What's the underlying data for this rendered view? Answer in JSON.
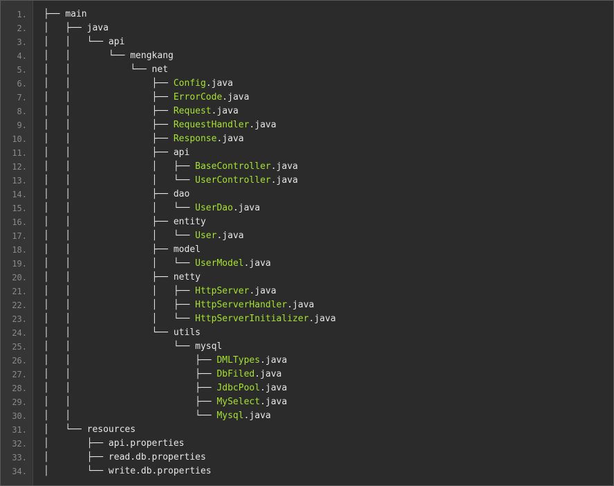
{
  "colors": {
    "background": "#2b2b2b",
    "gutter": "#353535",
    "line_number": "#8a8a8a",
    "text": "#e6e6e6",
    "class_name": "#a6e22e"
  },
  "lines": [
    {
      "num": "1.",
      "prefix": "├── ",
      "name": "",
      "rest": "main"
    },
    {
      "num": "2.",
      "prefix": "│   ├── ",
      "name": "",
      "rest": "java"
    },
    {
      "num": "3.",
      "prefix": "│   │   └── ",
      "name": "",
      "rest": "api"
    },
    {
      "num": "4.",
      "prefix": "│   │       └── ",
      "name": "",
      "rest": "mengkang"
    },
    {
      "num": "5.",
      "prefix": "│   │           └── ",
      "name": "",
      "rest": "net"
    },
    {
      "num": "6.",
      "prefix": "│   │               ├── ",
      "name": "Config",
      "rest": ".java"
    },
    {
      "num": "7.",
      "prefix": "│   │               ├── ",
      "name": "ErrorCode",
      "rest": ".java"
    },
    {
      "num": "8.",
      "prefix": "│   │               ├── ",
      "name": "Request",
      "rest": ".java"
    },
    {
      "num": "9.",
      "prefix": "│   │               ├── ",
      "name": "RequestHandler",
      "rest": ".java"
    },
    {
      "num": "10.",
      "prefix": "│   │               ├── ",
      "name": "Response",
      "rest": ".java"
    },
    {
      "num": "11.",
      "prefix": "│   │               ├── ",
      "name": "",
      "rest": "api"
    },
    {
      "num": "12.",
      "prefix": "│   │               │   ├── ",
      "name": "BaseController",
      "rest": ".java"
    },
    {
      "num": "13.",
      "prefix": "│   │               │   └── ",
      "name": "UserController",
      "rest": ".java"
    },
    {
      "num": "14.",
      "prefix": "│   │               ├── ",
      "name": "",
      "rest": "dao"
    },
    {
      "num": "15.",
      "prefix": "│   │               │   └── ",
      "name": "UserDao",
      "rest": ".java"
    },
    {
      "num": "16.",
      "prefix": "│   │               ├── ",
      "name": "",
      "rest": "entity"
    },
    {
      "num": "17.",
      "prefix": "│   │               │   └── ",
      "name": "User",
      "rest": ".java"
    },
    {
      "num": "18.",
      "prefix": "│   │               ├── ",
      "name": "",
      "rest": "model"
    },
    {
      "num": "19.",
      "prefix": "│   │               │   └── ",
      "name": "UserModel",
      "rest": ".java"
    },
    {
      "num": "20.",
      "prefix": "│   │               ├── ",
      "name": "",
      "rest": "netty"
    },
    {
      "num": "21.",
      "prefix": "│   │               │   ├── ",
      "name": "HttpServer",
      "rest": ".java"
    },
    {
      "num": "22.",
      "prefix": "│   │               │   ├── ",
      "name": "HttpServerHandler",
      "rest": ".java"
    },
    {
      "num": "23.",
      "prefix": "│   │               │   └── ",
      "name": "HttpServerInitializer",
      "rest": ".java"
    },
    {
      "num": "24.",
      "prefix": "│   │               └── ",
      "name": "",
      "rest": "utils"
    },
    {
      "num": "25.",
      "prefix": "│   │                   └── ",
      "name": "",
      "rest": "mysql"
    },
    {
      "num": "26.",
      "prefix": "│   │                       ├── ",
      "name": "DMLTypes",
      "rest": ".java"
    },
    {
      "num": "27.",
      "prefix": "│   │                       ├── ",
      "name": "DbFiled",
      "rest": ".java"
    },
    {
      "num": "28.",
      "prefix": "│   │                       ├── ",
      "name": "JdbcPool",
      "rest": ".java"
    },
    {
      "num": "29.",
      "prefix": "│   │                       ├── ",
      "name": "MySelect",
      "rest": ".java"
    },
    {
      "num": "30.",
      "prefix": "│   │                       └── ",
      "name": "Mysql",
      "rest": ".java"
    },
    {
      "num": "31.",
      "prefix": "│   └── ",
      "name": "",
      "rest": "resources"
    },
    {
      "num": "32.",
      "prefix": "│       ├── ",
      "name": "",
      "rest": "api.properties"
    },
    {
      "num": "33.",
      "prefix": "│       ├── ",
      "name": "",
      "rest": "read.db.properties"
    },
    {
      "num": "34.",
      "prefix": "│       └── ",
      "name": "",
      "rest": "write.db.properties"
    }
  ]
}
